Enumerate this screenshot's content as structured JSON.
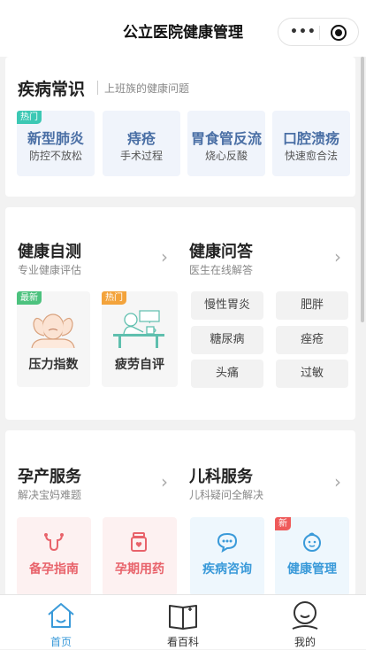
{
  "app": {
    "title": "公立医院健康管理"
  },
  "knowledge": {
    "title": "疾病常识",
    "subtitle": "上班族的健康问题",
    "tiles": [
      {
        "title": "新型肺炎",
        "desc": "防控不放松",
        "badge": "热门"
      },
      {
        "title": "痔疮",
        "desc": "手术过程"
      },
      {
        "title": "胃食管反流",
        "desc": "烧心反酸"
      },
      {
        "title": "口腔溃疡",
        "desc": "快速愈合法"
      }
    ]
  },
  "self_test": {
    "title": "健康自测",
    "subtitle": "专业健康评估",
    "items": [
      {
        "label": "压力指数",
        "badge": "最新"
      },
      {
        "label": "疲劳自评",
        "badge": "热门"
      }
    ]
  },
  "qa": {
    "title": "健康问答",
    "subtitle": "医生在线解答",
    "pills": [
      "慢性胃炎",
      "肥胖",
      "糖尿病",
      "痤疮",
      "头痛",
      "过敏"
    ]
  },
  "maternity": {
    "title": "孕产服务",
    "subtitle": "解决宝妈难题",
    "items": [
      {
        "label": "备孕指南"
      },
      {
        "label": "孕期用药"
      }
    ]
  },
  "pediatrics": {
    "title": "儿科服务",
    "subtitle": "儿科疑问全解决",
    "items": [
      {
        "label": "疾病咨询"
      },
      {
        "label": "健康管理",
        "badge": "新"
      }
    ]
  },
  "tabbar": [
    {
      "label": "首页",
      "active": true
    },
    {
      "label": "看百科"
    },
    {
      "label": "我的"
    }
  ],
  "colors": {
    "accent": "#3a9ad9",
    "knowledge_text": "#4a6fa5",
    "pink_text": "#e8636b",
    "hot_badge": "#3cc8b4",
    "new_badge": "#4cc27e",
    "orange_badge": "#f3a33b",
    "red_badge": "#ef5a5a"
  }
}
